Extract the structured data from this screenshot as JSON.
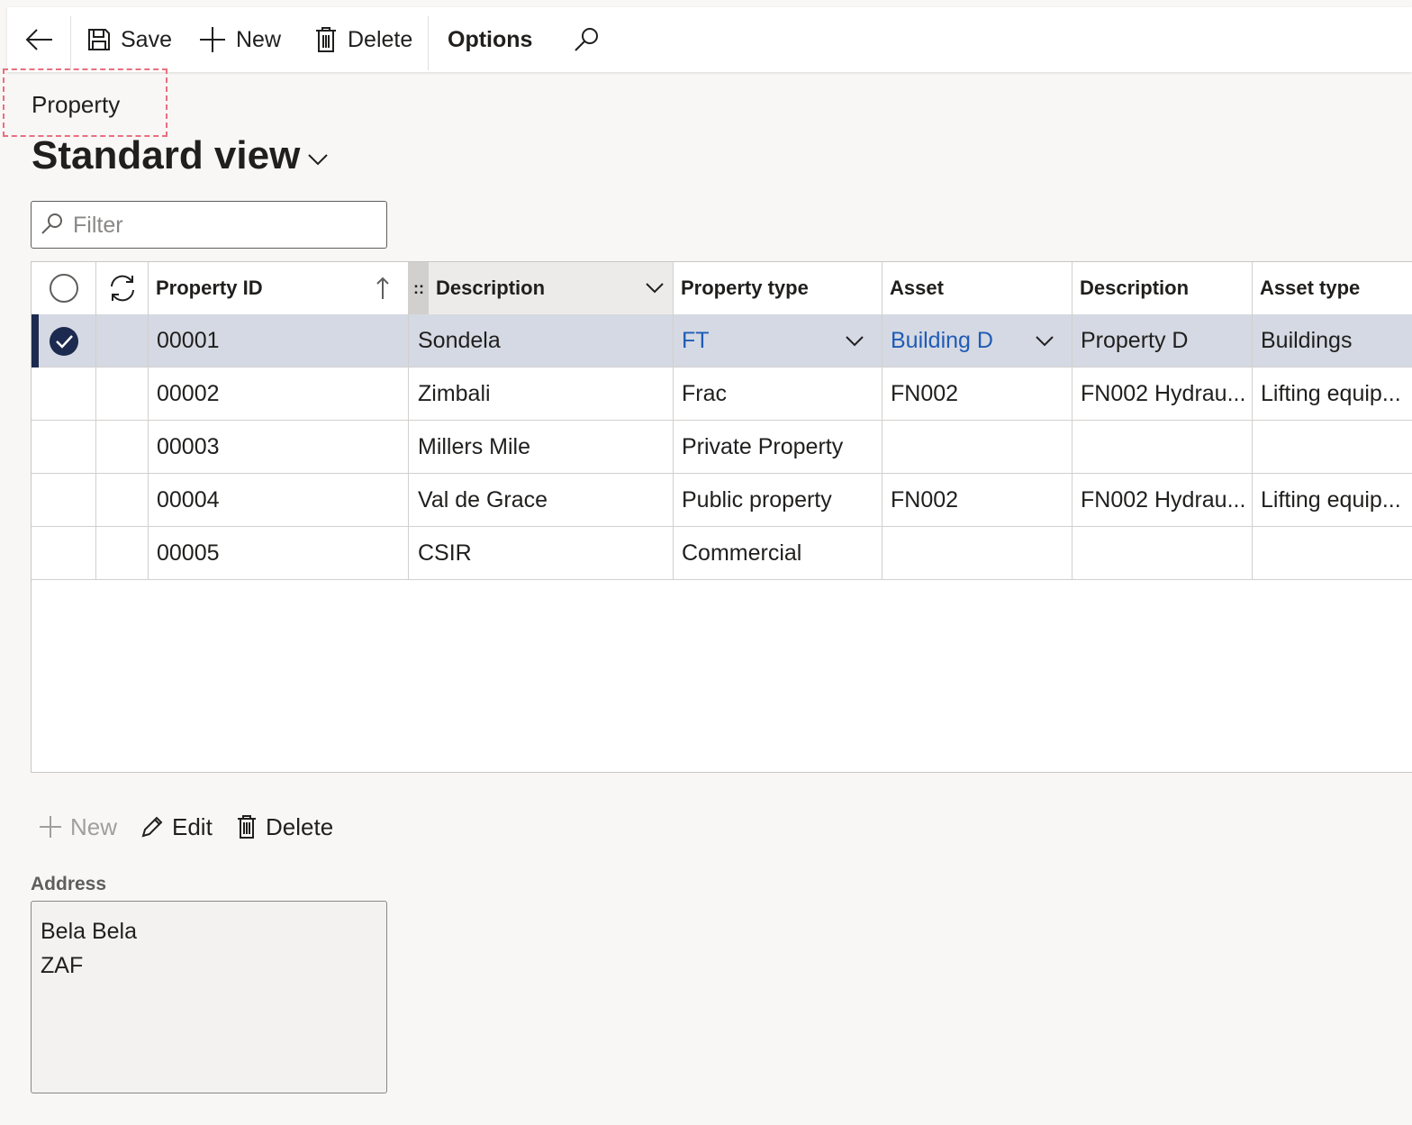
{
  "toolbar": {
    "save": "Save",
    "new": "New",
    "delete": "Delete",
    "options": "Options"
  },
  "breadcrumb": "Property",
  "view": {
    "title": "Standard view"
  },
  "filter": {
    "placeholder": "Filter"
  },
  "grid": {
    "columns": [
      "Property ID",
      "Description",
      "Property type",
      "Asset",
      "Description",
      "Asset type"
    ],
    "rows": [
      {
        "id": "00001",
        "description": "Sondela",
        "property_type": "FT",
        "asset": "Building D",
        "asset_description": "Property D",
        "asset_type": "Buildings",
        "selected": true
      },
      {
        "id": "00002",
        "description": "Zimbali",
        "property_type": "Frac",
        "asset": "FN002",
        "asset_description": "FN002 Hydrau...",
        "asset_type": "Lifting equip...",
        "selected": false
      },
      {
        "id": "00003",
        "description": "Millers Mile",
        "property_type": "Private Property",
        "asset": "",
        "asset_description": "",
        "asset_type": "",
        "selected": false
      },
      {
        "id": "00004",
        "description": "Val de Grace",
        "property_type": "Public property",
        "asset": "FN002",
        "asset_description": "FN002 Hydrau...",
        "asset_type": "Lifting equip...",
        "selected": false
      },
      {
        "id": "00005",
        "description": "CSIR",
        "property_type": "Commercial",
        "asset": "",
        "asset_description": "",
        "asset_type": "",
        "selected": false
      }
    ]
  },
  "actions": {
    "new": "New",
    "edit": "Edit",
    "delete": "Delete"
  },
  "address": {
    "label": "Address",
    "line1": "Bela Bela",
    "line2": "ZAF"
  },
  "colors": {
    "accent": "#1b2a4e",
    "link": "#1f5cb6",
    "selected_row": "#d5d9e3"
  }
}
